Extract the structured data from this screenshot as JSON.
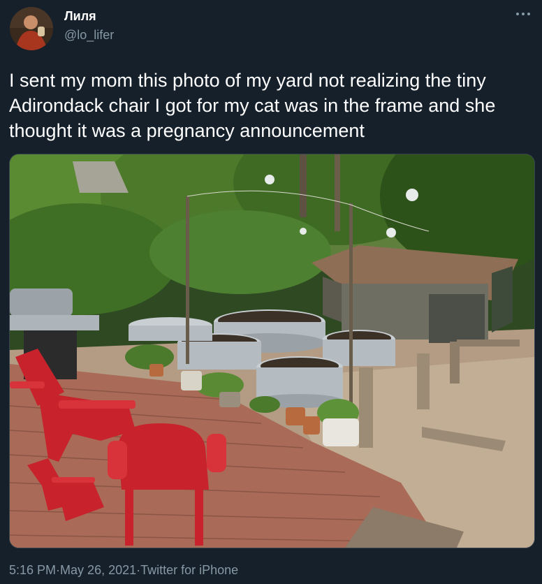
{
  "tweet": {
    "display_name": "Лиля",
    "handle": "@lo_lifer",
    "text": "I sent my mom this photo of my yard not realizing the tiny Adirondack chair I got for my cat was in the frame and she thought it was a pregnancy announcement",
    "time": "5:16 PM",
    "separator": " · ",
    "date": "May 26, 2021",
    "source": "Twitter for iPhone"
  },
  "icons": {
    "more": "more-options-icon",
    "avatar": "user-avatar"
  },
  "colors": {
    "background": "#15202b",
    "secondary_text": "#8899a6",
    "chair_red": "#c8232c"
  }
}
